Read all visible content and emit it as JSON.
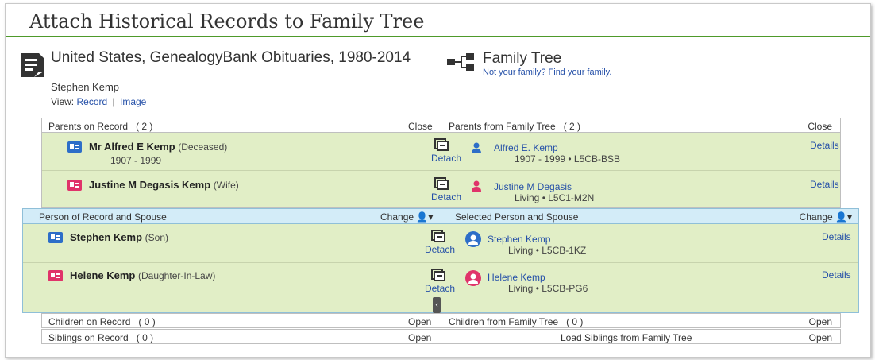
{
  "page_title": "Attach Historical Records to Family Tree",
  "record": {
    "title": "United States, GenealogyBank Obituaries, 1980-2014",
    "person": "Stephen Kemp",
    "view_label": "View:",
    "view_record": "Record",
    "view_separator": "|",
    "view_image": "Image"
  },
  "tree": {
    "title": "Family Tree",
    "not_your_family": "Not your family? Find your family."
  },
  "parents": {
    "record_header": "Parents on Record",
    "record_count": "( 2 )",
    "record_toggle": "Close",
    "tree_header": "Parents from Family Tree",
    "tree_count": "( 2 )",
    "tree_toggle": "Close",
    "rows": [
      {
        "name": "Mr Alfred E Kemp",
        "relation": "(Deceased)",
        "years": "1907 - 1999",
        "detach": "Detach",
        "tree_name": "Alfred E. Kemp",
        "tree_info": "1907 - 1999 • L5CB-BSB",
        "details": "Details",
        "gender": "male"
      },
      {
        "name": "Justine M Degasis Kemp",
        "relation": "(Wife)",
        "years": "",
        "detach": "Detach",
        "tree_name": "Justine M Degasis",
        "tree_info": "Living • L5C1-M2N",
        "details": "Details",
        "gender": "female"
      }
    ]
  },
  "spouse": {
    "record_header": "Person of Record and Spouse",
    "record_change": "Change",
    "tree_header": "Selected Person and Spouse",
    "tree_change": "Change",
    "rows": [
      {
        "name": "Stephen Kemp",
        "relation": "(Son)",
        "detach": "Detach",
        "tree_name": "Stephen Kemp",
        "tree_info": "Living • L5CB-1KZ",
        "details": "Details",
        "gender": "male"
      },
      {
        "name": "Helene Kemp",
        "relation": "(Daughter-In-Law)",
        "detach": "Detach",
        "tree_name": "Helene Kemp",
        "tree_info": "Living • L5CB-PG6",
        "details": "Details",
        "gender": "female"
      }
    ]
  },
  "children": {
    "record_header": "Children on Record",
    "record_count": "( 0 )",
    "record_toggle": "Open",
    "tree_header": "Children from Family Tree",
    "tree_count": "( 0 )",
    "tree_toggle": "Open"
  },
  "siblings": {
    "record_header": "Siblings on Record",
    "record_count": "( 0 )",
    "record_toggle": "Open",
    "tree_load": "Load Siblings from Family Tree",
    "tree_toggle": "Open"
  },
  "colors": {
    "accent_green": "#4e9a2a",
    "row_green": "#e1eec6",
    "header_blue": "#d3ecf8",
    "link_blue": "#2550a8",
    "male_blue": "#2d6ec8",
    "female_pink": "#e0336a"
  },
  "icons": {
    "record": "document-icon",
    "tree": "family-tree-icon",
    "detach": "detach-icon",
    "change": "person-dropdown-icon",
    "collapse": "chevron-left-icon"
  }
}
